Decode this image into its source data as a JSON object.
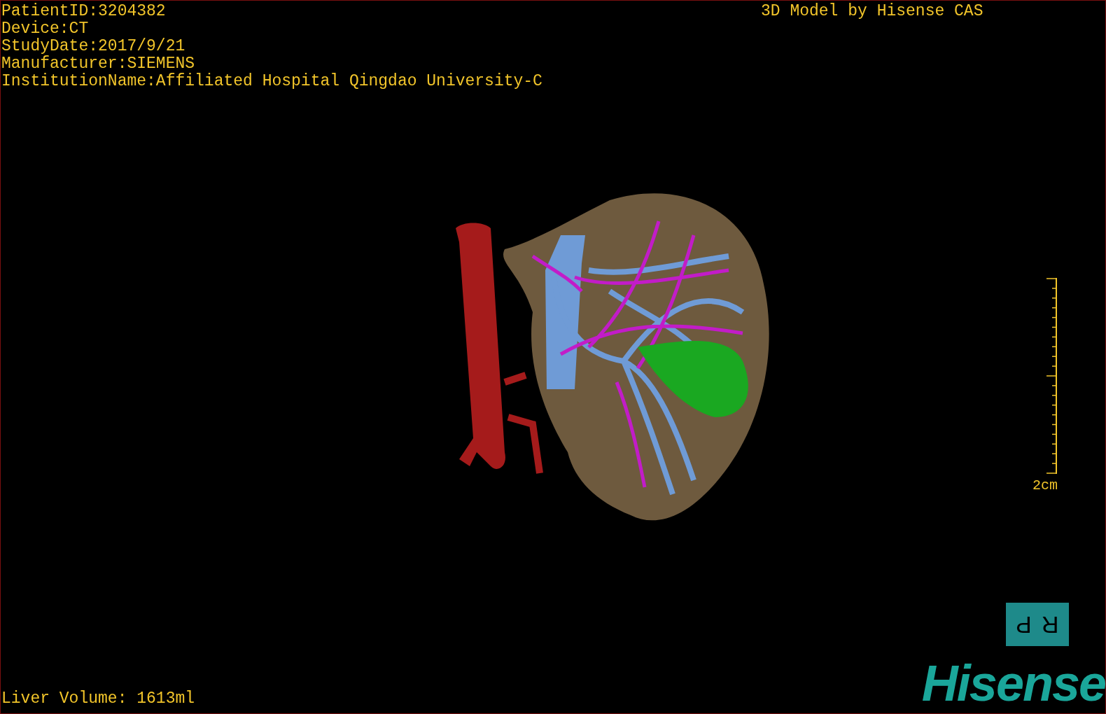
{
  "info_lines": [
    "PatientID:3204382",
    "Device:CT",
    "StudyDate:2017/9/21",
    "Manufacturer:SIEMENS",
    "InstitutionName:Affiliated Hospital Qingdao University-C"
  ],
  "model_caption": "3D Model by Hisense CAS",
  "scale_bar": {
    "label": "2cm"
  },
  "orientation_cube": [
    "P",
    "R"
  ],
  "liver_volume": "Liver Volume: 1613ml",
  "logo": "Hisense"
}
